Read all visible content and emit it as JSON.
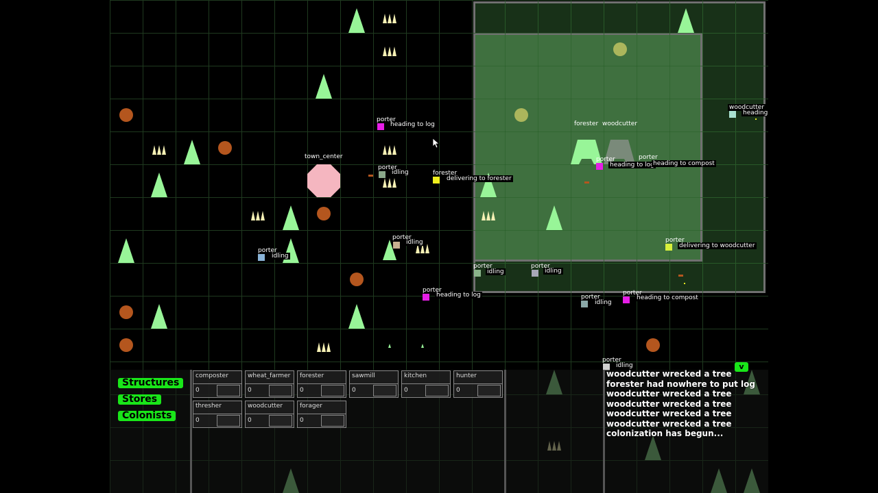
{
  "colors": {
    "tree": "#98f598",
    "rock": "#b4561e",
    "wheat": "#f5f0b4",
    "town_center": "#f5b6c0",
    "magenta": "#e61ee6",
    "yellow": "#f0f01e",
    "ui_green": "#19e619"
  },
  "buildings": {
    "town_center": "town_center",
    "forester": "forester",
    "woodcutter": "woodcutter"
  },
  "woodcutter_offscreen_label": "woodcutter",
  "offscreen_status": "heading",
  "colonists": [
    {
      "role": "porter",
      "status": "heading to log",
      "color": "#e61ee6"
    },
    {
      "role": "porter",
      "status": "idling",
      "color": "#8aa88a"
    },
    {
      "role": "forester",
      "status": "delivering to forester",
      "color": "#f0f01e"
    },
    {
      "role": "porter",
      "status": "idling",
      "color": "#c8b090"
    },
    {
      "role": "porter",
      "status": "idling",
      "color": "#8ab4d8"
    },
    {
      "role": "porter",
      "status": "heading to log",
      "color": "#e61ee6"
    },
    {
      "role": "porter",
      "status": "heading to log",
      "color": "#e61ee6"
    },
    {
      "role": "porter",
      "status": "heading to compost",
      "color": "#e61ee6"
    },
    {
      "role": "porter",
      "status": "delivering to woodcutter",
      "color": "#d8f03c"
    },
    {
      "role": "porter",
      "status": "idling",
      "color": "#8ab48a"
    },
    {
      "role": "porter",
      "status": "idling",
      "color": "#a8a8b8"
    },
    {
      "role": "porter",
      "status": "idling",
      "color": "#8aa8a8"
    },
    {
      "role": "porter",
      "status": "heading to compost",
      "color": "#e61ee6"
    },
    {
      "role": "porter",
      "status": "idling",
      "color": "#d0d0d0"
    }
  ],
  "menu": {
    "structures": "Structures",
    "stores": "Stores",
    "colonists": "Colonists"
  },
  "structure_cards": [
    {
      "name": "composter",
      "count": "0"
    },
    {
      "name": "wheat_farmer",
      "count": "0"
    },
    {
      "name": "forester",
      "count": "0"
    },
    {
      "name": "sawmill",
      "count": "0"
    },
    {
      "name": "kitchen",
      "count": "0"
    },
    {
      "name": "hunter",
      "count": "0"
    },
    {
      "name": "thresher",
      "count": "0"
    },
    {
      "name": "woodcutter",
      "count": "0"
    },
    {
      "name": "forager",
      "count": "0"
    }
  ],
  "log_toggle": "v",
  "event_log": [
    "woodcutter wrecked a tree",
    "forester had nowhere to put log",
    "woodcutter wrecked a tree",
    "woodcutter wrecked a tree",
    "woodcutter wrecked a tree",
    "woodcutter wrecked a tree",
    "colonization has begun..."
  ]
}
